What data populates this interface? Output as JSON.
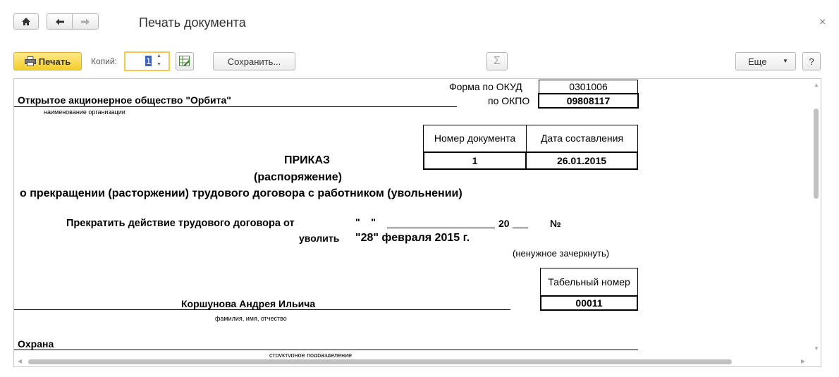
{
  "window": {
    "title": "Печать документа",
    "close_glyph": "×"
  },
  "toolbar": {
    "print_label": "Печать",
    "copies_label": "Копий:",
    "copies_value": "1",
    "save_label": "Сохранить...",
    "sum_glyph": "Σ",
    "more_label": "Еще",
    "help_label": "?"
  },
  "document": {
    "okud_label": "Форма по ОКУД",
    "okud_code": "0301006",
    "okpo_label": "по ОКПО",
    "okpo_code": "09808117",
    "org_name": "Открытое акционерное общество \"Орбита\"",
    "org_caption": "наименование организации",
    "doc_number_header": "Номер документа",
    "doc_date_header": "Дата составления",
    "doc_number": "1",
    "doc_date": "26.01.2015",
    "title": "ПРИКАЗ",
    "subtitle": "(распоряжение)",
    "subject": "о прекращении (расторжении) трудового договора с работником (увольнении)",
    "terminate_label": "Прекратить действие трудового договора от",
    "terminate_quote": "\"    \"",
    "terminate_year": "20",
    "terminate_number": "№",
    "dismiss_label": "уволить",
    "dismiss_date": "\"28\" февраля 2015 г.",
    "strike_note": "(ненужное зачеркнуть)",
    "tab_number_header": "Табельный номер",
    "tab_number": "00011",
    "employee_name": "Коршунова Андрея Ильича",
    "employee_caption": "фамилия, имя, отчество",
    "department": "Охрана",
    "department_caption": "структурное подразделение"
  }
}
